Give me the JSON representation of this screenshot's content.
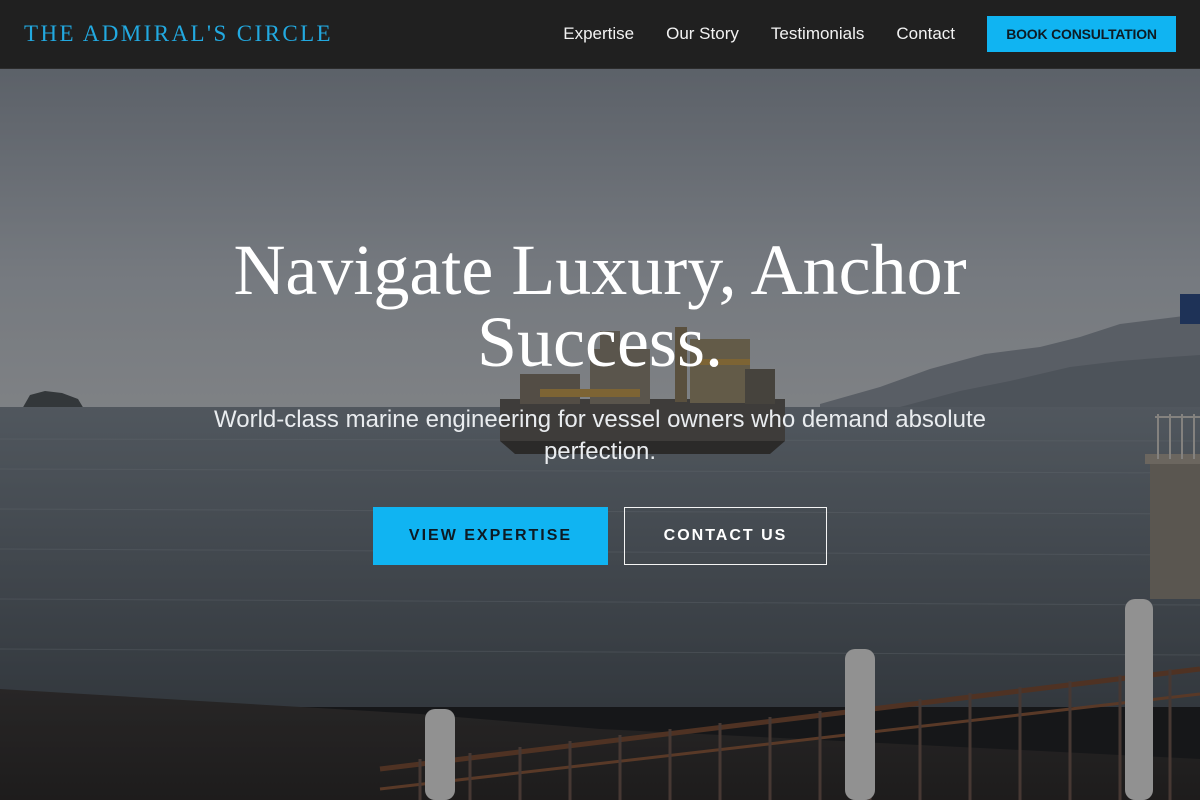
{
  "header": {
    "brand": "THE ADMIRAL'S CIRCLE",
    "nav": [
      "Expertise",
      "Our Story",
      "Testimonials",
      "Contact"
    ],
    "cta": "BOOK CONSULTATION"
  },
  "hero": {
    "title": "Navigate Luxury, Anchor Success.",
    "subtitle": "World-class marine engineering for vessel owners who demand absolute perfection.",
    "primary_button": "VIEW EXPERTISE",
    "secondary_button": "CONTACT US"
  },
  "colors": {
    "accent": "#10b4f2",
    "brand_text": "#22a9e0",
    "header_bg": "#202020"
  },
  "icons": {
    "hero_image": "harbor-dredger-photo"
  }
}
